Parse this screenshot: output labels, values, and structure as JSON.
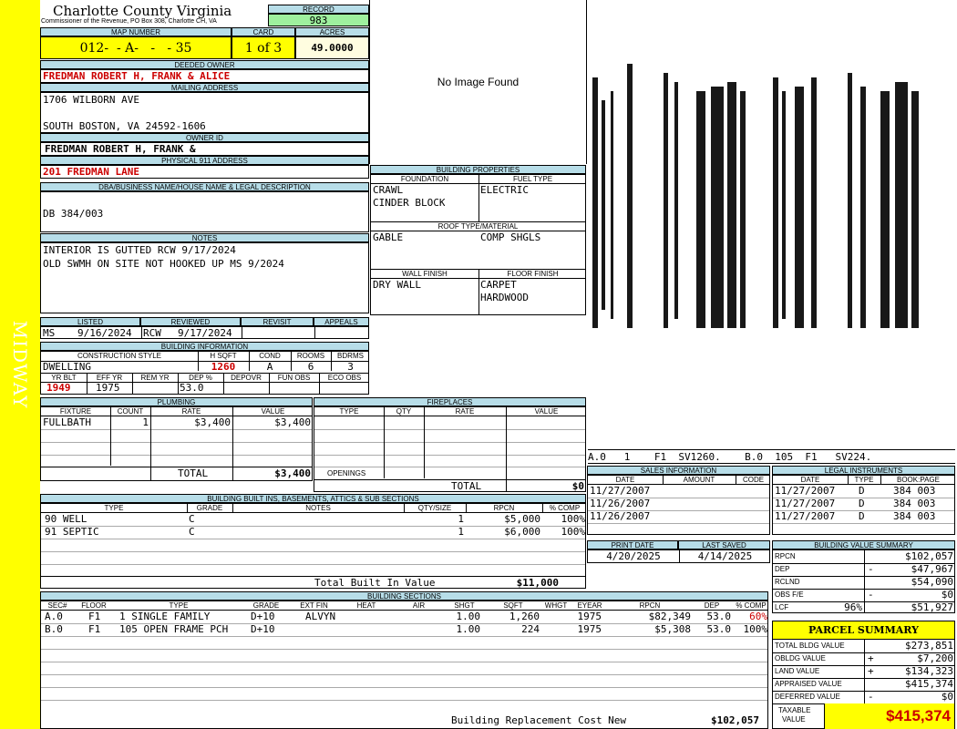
{
  "sidebar": {
    "label": "MIDWAY"
  },
  "header": {
    "county": "Charlotte County Virginia",
    "address": "Commissioner of the Revenue, PO Box 308, Charlotte CH, VA",
    "record_label": "RECORD",
    "record": "983",
    "map_label": "MAP NUMBER",
    "map": "012-  - A-   -   - 35",
    "card_label": "CARD",
    "card": "1 of 3",
    "acres_label": "ACRES",
    "acres": "49.0000"
  },
  "owner": {
    "deeded_label": "DEEDED OWNER",
    "deeded": "FREDMAN ROBERT H, FRANK & ALICE",
    "mailing_label": "MAILING ADDRESS",
    "mail1": "1706 WILBORN AVE",
    "mail2": "SOUTH BOSTON, VA 24592-1606",
    "ownerid_label": "OWNER ID",
    "ownerid": "FREDMAN ROBERT H, FRANK &",
    "phys_label": "PHYSICAL 911 ADDRESS",
    "phys": "201 FREDMAN LANE"
  },
  "legal": {
    "label": "DBA/BUSINESS NAME/HOUSE NAME & LEGAL DESCRIPTION",
    "text": "DB 384/003"
  },
  "notes": {
    "label": "NOTES",
    "line1": "INTERIOR IS GUTTED RCW 9/17/2024",
    "line2": "OLD SWMH ON SITE NOT HOOKED UP MS 9/2024"
  },
  "listing": {
    "listed_label": "LISTED",
    "listed_by": "MS",
    "listed_date": "9/16/2024",
    "reviewed_label": "REVIEWED",
    "reviewed_by": "RCW",
    "reviewed_date": "9/17/2024",
    "revisit_label": "REVISIT",
    "appeals_label": "APPEALS"
  },
  "building_info": {
    "label": "BUILDING INFORMATION",
    "style_label": "CONSTRUCTION STYLE",
    "hsqft_label": "H SQFT",
    "cond_label": "COND",
    "rooms_label": "ROOMS",
    "bdrms_label": "BDRMS",
    "style": "DWELLING",
    "hsqft": "1260",
    "cond": "A",
    "rooms": "6",
    "bdrms": "3",
    "yrblt_label": "YR BLT",
    "effyr_label": "EFF YR",
    "remyr_label": "REM YR",
    "dep_label": "DEP %",
    "depovr_label": "DEPOVR",
    "funobs_label": "FUN OBS",
    "ecoobs_label": "ECO OBS",
    "yrblt": "1949",
    "effyr": "1975",
    "dep": "53.0"
  },
  "image": {
    "text": "No Image Found"
  },
  "sketch": {
    "caption": "A.0   1    F1  SV1260.    B.0  105  F1   SV224."
  },
  "props": {
    "label": "BUILDING PROPERTIES",
    "foundation_label": "FOUNDATION",
    "fuel_label": "FUEL TYPE",
    "foundation1": "CRAWL",
    "foundation2": "CINDER BLOCK",
    "fuel": "ELECTRIC",
    "roof_label": "ROOF TYPE/MATERIAL",
    "roof1": "GABLE",
    "roof2": "COMP SHGLS",
    "wall_label": "WALL FINISH",
    "floor_label": "FLOOR FINISH",
    "wall": "DRY WALL",
    "floor1": "CARPET",
    "floor2": "HARDWOOD"
  },
  "plumbing": {
    "label": "PLUMBING",
    "headers": [
      "FIXTURE",
      "COUNT",
      "RATE",
      "VALUE"
    ],
    "fixture": "FULLBATH",
    "count": "1",
    "rate": "$3,400",
    "value": "$3,400",
    "total_label": "TOTAL",
    "total": "$3,400"
  },
  "fireplaces": {
    "label": "FIREPLACES",
    "headers": [
      "TYPE",
      "QTY",
      "RATE",
      "VALUE"
    ],
    "openings_label": "OPENINGS",
    "total_label": "TOTAL",
    "total": "$0"
  },
  "sales": {
    "label": "SALES INFORMATION",
    "headers": [
      "DATE",
      "AMOUNT",
      "CODE"
    ],
    "dates": [
      "11/27/2007",
      "11/26/2007",
      "11/26/2007"
    ]
  },
  "legal_inst": {
    "label": "LEGAL INSTRUMENTS",
    "headers": [
      "DATE",
      "TYPE",
      "BOOK:PAGE"
    ],
    "rows": [
      {
        "date": "11/27/2007",
        "type": "D",
        "book": "384 003"
      },
      {
        "date": "11/27/2007",
        "type": "D",
        "book": "384 003"
      },
      {
        "date": "11/27/2007",
        "type": "D",
        "book": "384 003"
      }
    ]
  },
  "print": {
    "print_label": "PRINT DATE",
    "saved_label": "LAST SAVED",
    "print": "4/20/2025",
    "saved": "4/14/2025"
  },
  "builtins": {
    "label": "BUILDING BUILT INS, BASEMENTS, ATTICS & SUB SECTIONS",
    "headers": [
      "TYPE",
      "GRADE",
      "NOTES",
      "QTY/SIZE",
      "RPCN",
      "% COMP"
    ],
    "rows": [
      {
        "type": "90 WELL",
        "grade": "C",
        "qty": "1",
        "rpcn": "$5,000",
        "comp": "100%"
      },
      {
        "type": "91 SEPTIC",
        "grade": "C",
        "qty": "1",
        "rpcn": "$6,000",
        "comp": "100%"
      }
    ],
    "total_label": "Total Built In Value",
    "total": "$11,000"
  },
  "sections": {
    "label": "BUILDING SECTIONS",
    "headers": [
      "SEC#",
      "FLOOR",
      "TYPE",
      "GRADE",
      "EXT FIN",
      "HEAT",
      "AIR",
      "SHGT",
      "SQFT",
      "WHGT",
      "EYEAR",
      "RPCN",
      "DEP",
      "% COMP"
    ],
    "rows": [
      {
        "sec": "A.0",
        "floor": "F1",
        "type": "1 SINGLE FAMILY",
        "grade": "D+10",
        "ext": "ALVYN",
        "shgt": "1.00",
        "sqft": "1,260",
        "eyear": "1975",
        "rpcn": "$82,349",
        "dep": "53.0",
        "comp": "60%"
      },
      {
        "sec": "B.0",
        "floor": "F1",
        "type": "105 OPEN FRAME PCH",
        "grade": "D+10",
        "ext": "",
        "shgt": "1.00",
        "sqft": "224",
        "eyear": "1975",
        "rpcn": "$5,308",
        "dep": "53.0",
        "comp": "100%"
      }
    ],
    "rcn_label": "Building Replacement Cost New",
    "rcn": "$102,057"
  },
  "value_summary": {
    "label": "BUILDING VALUE SUMMARY",
    "rpcn_label": "RPCN",
    "rpcn": "$102,057",
    "dep_label": "DEP",
    "dep_sign": "-",
    "dep": "$47,967",
    "rclnd_label": "RCLND",
    "rclnd": "$54,090",
    "obs_label": "OBS F/E",
    "obs_sign": "-",
    "obs": "$0",
    "lcf_label": "LCF",
    "lcf_pct": "96%",
    "lcf": "$51,927"
  },
  "parcel": {
    "label": "PARCEL SUMMARY",
    "tbv_label": "TOTAL BLDG VALUE",
    "tbv": "$273,851",
    "obldg_label": "OBLDG VALUE",
    "obldg_sign": "+",
    "obldg": "$7,200",
    "land_label": "LAND VALUE",
    "land_sign": "+",
    "land": "$134,323",
    "appr_label": "APPRAISED VALUE",
    "appr": "$415,374",
    "defer_label": "DEFERRED VALUE",
    "defer_sign": "-",
    "defer": "$0",
    "taxable_label1": "TAXABLE",
    "taxable_label2": "VALUE",
    "taxable": "$415,374"
  }
}
